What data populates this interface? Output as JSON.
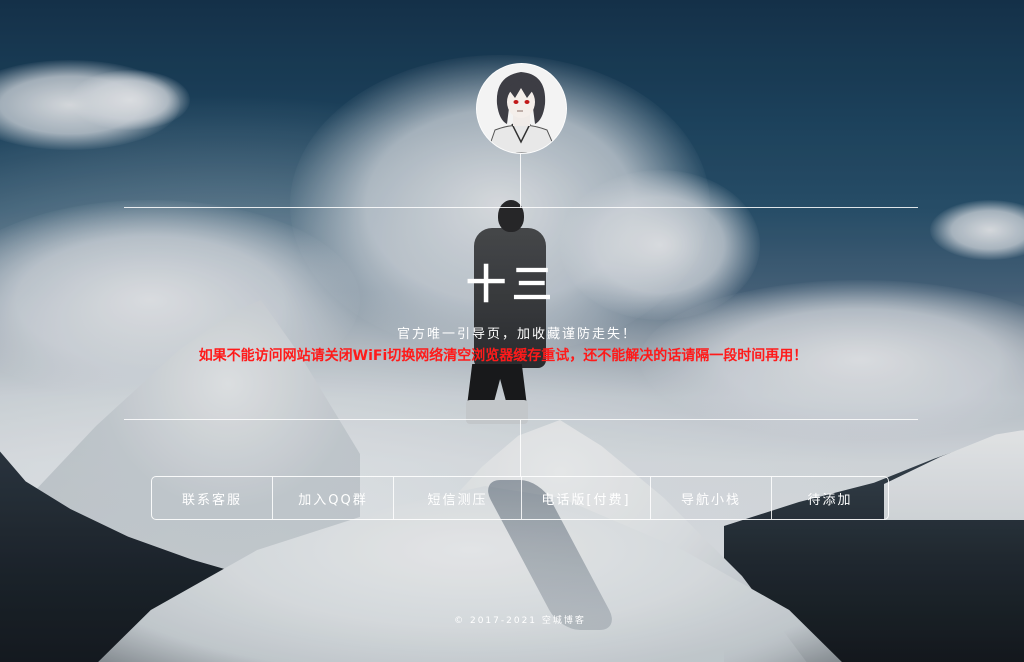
{
  "header": {
    "title": "十三",
    "subtitle": "官方唯一引导页，加收藏谨防走失！",
    "notice": "如果不能访问网站请关闭WiFi切换网络清空浏览器缓存重试，还不能解决的话请隔一段时间再用！"
  },
  "nav": {
    "items": [
      {
        "label": "联系客服"
      },
      {
        "label": "加入QQ群"
      },
      {
        "label": "短信测压"
      },
      {
        "label": "电话版[付费]"
      },
      {
        "label": "导航小栈"
      },
      {
        "label": "待添加"
      }
    ]
  },
  "footer": {
    "copyright": "© 2017-2021 空城博客"
  },
  "colors": {
    "notice": "#ff1a1a",
    "lines": "#ffffff"
  }
}
